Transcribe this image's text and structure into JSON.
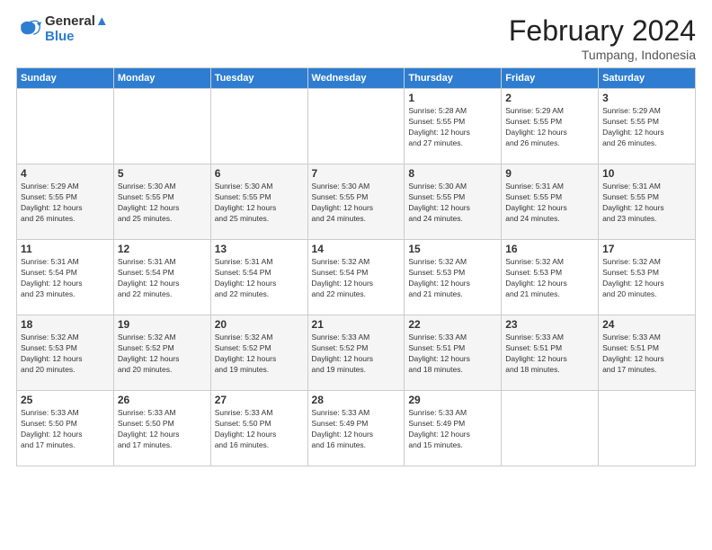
{
  "header": {
    "logo_line1": "General",
    "logo_line2": "Blue",
    "title": "February 2024",
    "location": "Tumpang, Indonesia"
  },
  "days_of_week": [
    "Sunday",
    "Monday",
    "Tuesday",
    "Wednesday",
    "Thursday",
    "Friday",
    "Saturday"
  ],
  "weeks": [
    [
      {
        "day": "",
        "info": ""
      },
      {
        "day": "",
        "info": ""
      },
      {
        "day": "",
        "info": ""
      },
      {
        "day": "",
        "info": ""
      },
      {
        "day": "1",
        "info": "Sunrise: 5:28 AM\nSunset: 5:55 PM\nDaylight: 12 hours\nand 27 minutes."
      },
      {
        "day": "2",
        "info": "Sunrise: 5:29 AM\nSunset: 5:55 PM\nDaylight: 12 hours\nand 26 minutes."
      },
      {
        "day": "3",
        "info": "Sunrise: 5:29 AM\nSunset: 5:55 PM\nDaylight: 12 hours\nand 26 minutes."
      }
    ],
    [
      {
        "day": "4",
        "info": "Sunrise: 5:29 AM\nSunset: 5:55 PM\nDaylight: 12 hours\nand 26 minutes."
      },
      {
        "day": "5",
        "info": "Sunrise: 5:30 AM\nSunset: 5:55 PM\nDaylight: 12 hours\nand 25 minutes."
      },
      {
        "day": "6",
        "info": "Sunrise: 5:30 AM\nSunset: 5:55 PM\nDaylight: 12 hours\nand 25 minutes."
      },
      {
        "day": "7",
        "info": "Sunrise: 5:30 AM\nSunset: 5:55 PM\nDaylight: 12 hours\nand 24 minutes."
      },
      {
        "day": "8",
        "info": "Sunrise: 5:30 AM\nSunset: 5:55 PM\nDaylight: 12 hours\nand 24 minutes."
      },
      {
        "day": "9",
        "info": "Sunrise: 5:31 AM\nSunset: 5:55 PM\nDaylight: 12 hours\nand 24 minutes."
      },
      {
        "day": "10",
        "info": "Sunrise: 5:31 AM\nSunset: 5:55 PM\nDaylight: 12 hours\nand 23 minutes."
      }
    ],
    [
      {
        "day": "11",
        "info": "Sunrise: 5:31 AM\nSunset: 5:54 PM\nDaylight: 12 hours\nand 23 minutes."
      },
      {
        "day": "12",
        "info": "Sunrise: 5:31 AM\nSunset: 5:54 PM\nDaylight: 12 hours\nand 22 minutes."
      },
      {
        "day": "13",
        "info": "Sunrise: 5:31 AM\nSunset: 5:54 PM\nDaylight: 12 hours\nand 22 minutes."
      },
      {
        "day": "14",
        "info": "Sunrise: 5:32 AM\nSunset: 5:54 PM\nDaylight: 12 hours\nand 22 minutes."
      },
      {
        "day": "15",
        "info": "Sunrise: 5:32 AM\nSunset: 5:53 PM\nDaylight: 12 hours\nand 21 minutes."
      },
      {
        "day": "16",
        "info": "Sunrise: 5:32 AM\nSunset: 5:53 PM\nDaylight: 12 hours\nand 21 minutes."
      },
      {
        "day": "17",
        "info": "Sunrise: 5:32 AM\nSunset: 5:53 PM\nDaylight: 12 hours\nand 20 minutes."
      }
    ],
    [
      {
        "day": "18",
        "info": "Sunrise: 5:32 AM\nSunset: 5:53 PM\nDaylight: 12 hours\nand 20 minutes."
      },
      {
        "day": "19",
        "info": "Sunrise: 5:32 AM\nSunset: 5:52 PM\nDaylight: 12 hours\nand 20 minutes."
      },
      {
        "day": "20",
        "info": "Sunrise: 5:32 AM\nSunset: 5:52 PM\nDaylight: 12 hours\nand 19 minutes."
      },
      {
        "day": "21",
        "info": "Sunrise: 5:33 AM\nSunset: 5:52 PM\nDaylight: 12 hours\nand 19 minutes."
      },
      {
        "day": "22",
        "info": "Sunrise: 5:33 AM\nSunset: 5:51 PM\nDaylight: 12 hours\nand 18 minutes."
      },
      {
        "day": "23",
        "info": "Sunrise: 5:33 AM\nSunset: 5:51 PM\nDaylight: 12 hours\nand 18 minutes."
      },
      {
        "day": "24",
        "info": "Sunrise: 5:33 AM\nSunset: 5:51 PM\nDaylight: 12 hours\nand 17 minutes."
      }
    ],
    [
      {
        "day": "25",
        "info": "Sunrise: 5:33 AM\nSunset: 5:50 PM\nDaylight: 12 hours\nand 17 minutes."
      },
      {
        "day": "26",
        "info": "Sunrise: 5:33 AM\nSunset: 5:50 PM\nDaylight: 12 hours\nand 17 minutes."
      },
      {
        "day": "27",
        "info": "Sunrise: 5:33 AM\nSunset: 5:50 PM\nDaylight: 12 hours\nand 16 minutes."
      },
      {
        "day": "28",
        "info": "Sunrise: 5:33 AM\nSunset: 5:49 PM\nDaylight: 12 hours\nand 16 minutes."
      },
      {
        "day": "29",
        "info": "Sunrise: 5:33 AM\nSunset: 5:49 PM\nDaylight: 12 hours\nand 15 minutes."
      },
      {
        "day": "",
        "info": ""
      },
      {
        "day": "",
        "info": ""
      }
    ]
  ]
}
